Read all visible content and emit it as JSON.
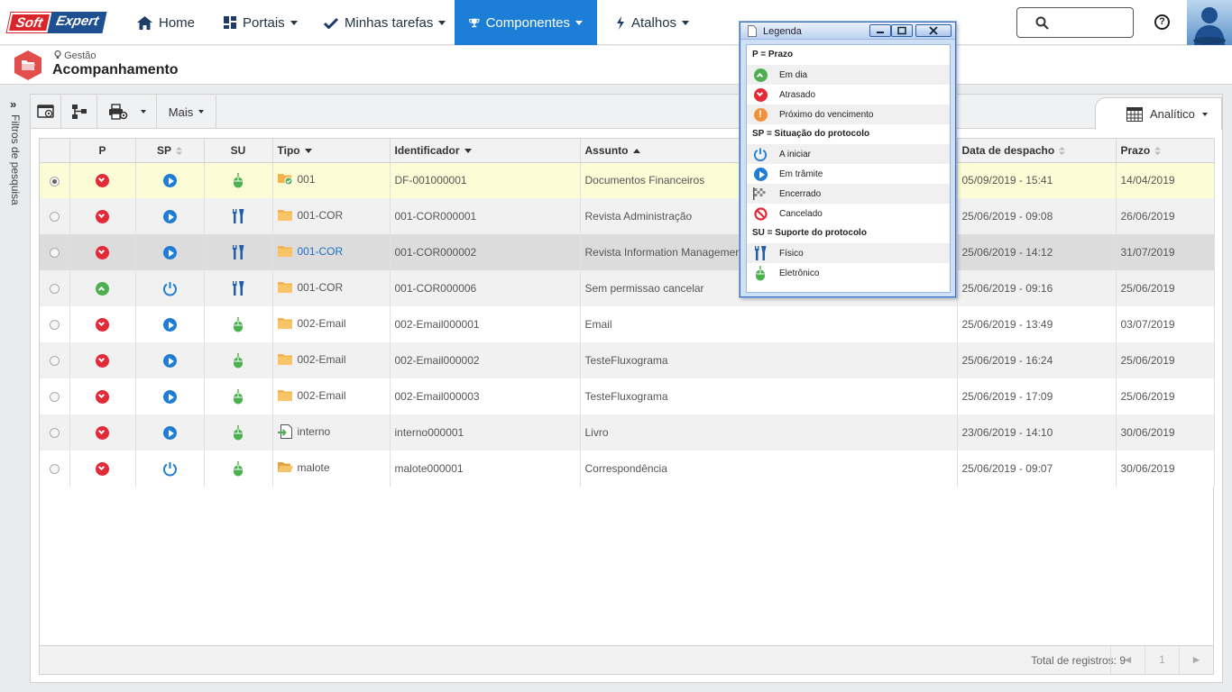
{
  "brand": {
    "part1": "Soft",
    "part2": "Expert"
  },
  "nav": {
    "items": [
      {
        "label": "Home"
      },
      {
        "label": "Portais"
      },
      {
        "label": "Minhas tarefas"
      },
      {
        "label": "Componentes"
      },
      {
        "label": "Atalhos"
      }
    ],
    "help_label": "?"
  },
  "header": {
    "breadcrumb": "Gestão",
    "title": "Acompanhamento"
  },
  "sidebar": {
    "filter_label": "Filtros de pesquisa",
    "expand_glyph": "»"
  },
  "toolbar": {
    "more_label": "Mais",
    "view_label": "Analítico"
  },
  "table": {
    "columns": [
      "",
      "P",
      "SP",
      "SU",
      "Tipo",
      "Identificador",
      "Assunto",
      "Data de despacho",
      "Prazo"
    ],
    "rows": [
      {
        "p": "atrasado",
        "sp": "em-tramite",
        "su": "eletronico",
        "tipo": "001",
        "tipo_icon": "folder-check",
        "id": "DF-001000001",
        "assunto": "Documentos Financeiros",
        "data": "05/09/2019 - 15:41",
        "prazo": "14/04/2019"
      },
      {
        "p": "atrasado",
        "sp": "em-tramite",
        "su": "fisico",
        "tipo": "001-COR",
        "tipo_icon": "folder",
        "id": "001-COR000001",
        "assunto": "Revista Administração",
        "data": "25/06/2019 - 09:08",
        "prazo": "26/06/2019"
      },
      {
        "p": "atrasado",
        "sp": "em-tramite",
        "su": "fisico",
        "tipo": "001-COR",
        "tipo_icon": "folder",
        "id": "001-COR000002",
        "assunto": "Revista Information Management",
        "data": "25/06/2019 - 14:12",
        "prazo": "31/07/2019"
      },
      {
        "p": "em-dia",
        "sp": "a-iniciar",
        "su": "fisico",
        "tipo": "001-COR",
        "tipo_icon": "folder",
        "id": "001-COR000006",
        "assunto": "Sem permissao cancelar",
        "data": "25/06/2019 - 09:16",
        "prazo": "25/06/2019"
      },
      {
        "p": "atrasado",
        "sp": "em-tramite",
        "su": "eletronico",
        "tipo": "002-Email",
        "tipo_icon": "folder",
        "id": "002-Email000001",
        "assunto": "Email",
        "data": "25/06/2019 - 13:49",
        "prazo": "03/07/2019"
      },
      {
        "p": "atrasado",
        "sp": "em-tramite",
        "su": "eletronico",
        "tipo": "002-Email",
        "tipo_icon": "folder",
        "id": "002-Email000002",
        "assunto": "TesteFluxograma",
        "data": "25/06/2019 - 16:24",
        "prazo": "25/06/2019"
      },
      {
        "p": "atrasado",
        "sp": "em-tramite",
        "su": "eletronico",
        "tipo": "002-Email",
        "tipo_icon": "folder",
        "id": "002-Email000003",
        "assunto": "TesteFluxograma",
        "data": "25/06/2019 - 17:09",
        "prazo": "25/06/2019"
      },
      {
        "p": "atrasado",
        "sp": "em-tramite",
        "su": "eletronico",
        "tipo": "interno",
        "tipo_icon": "document-arrow",
        "id": "interno000001",
        "assunto": "Livro",
        "data": "23/06/2019 - 14:10",
        "prazo": "30/06/2019"
      },
      {
        "p": "atrasado",
        "sp": "a-iniciar",
        "su": "eletronico",
        "tipo": "malote",
        "tipo_icon": "folder-open",
        "id": "malote000001",
        "assunto": "Correspondência",
        "data": "25/06/2019 - 09:07",
        "prazo": "30/06/2019"
      }
    ]
  },
  "footer": {
    "total_label": "Total de registros: 9",
    "page": "1",
    "prev_glyph": "◄",
    "next_glyph": "►"
  },
  "legend": {
    "title": "Legenda",
    "sections": [
      {
        "heading": "P = Prazo",
        "items": [
          {
            "icon": "em-dia",
            "label": "Em dia"
          },
          {
            "icon": "atrasado",
            "label": "Atrasado"
          },
          {
            "icon": "proximo",
            "label": "Próximo do vencimento"
          }
        ]
      },
      {
        "heading": "SP = Situação do protocolo",
        "items": [
          {
            "icon": "a-iniciar",
            "label": "A iniciar"
          },
          {
            "icon": "em-tramite",
            "label": "Em trâmite"
          },
          {
            "icon": "encerrado",
            "label": "Encerrado"
          },
          {
            "icon": "cancelado",
            "label": "Cancelado"
          }
        ]
      },
      {
        "heading": "SU = Suporte do protocolo",
        "items": [
          {
            "icon": "fisico",
            "label": "Físico"
          },
          {
            "icon": "eletronico",
            "label": "Eletrônico"
          }
        ]
      }
    ]
  },
  "colors": {
    "accent": "#1c7ed6",
    "danger": "#e32a36",
    "success": "#4caf50",
    "warning": "#f1923a",
    "selected_row": "#fcfcd7"
  }
}
